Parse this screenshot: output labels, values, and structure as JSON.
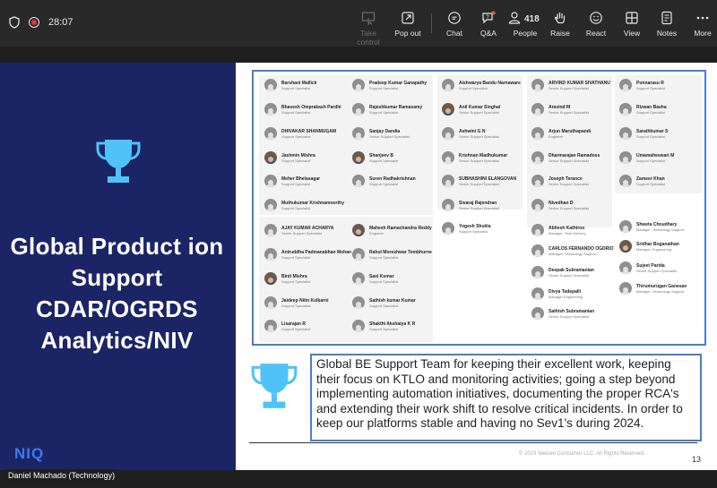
{
  "toolbar": {
    "elapsed_time": "28:07",
    "participant_count": "418",
    "buttons": {
      "take_control": "Take control",
      "pop_out": "Pop out",
      "chat": "Chat",
      "qa": "Q&A",
      "people": "People",
      "raise": "Raise",
      "react": "React",
      "view": "View",
      "notes": "Notes",
      "more": "More"
    }
  },
  "slide": {
    "title": "Global Product ion Support CDAR/OGRDS Analytics/NIV",
    "logo_text": "NIQ",
    "award_text": "Global BE Support Team for keeping their excellent work, keeping their focus on KTLO and monitoring activities; going a step beyond implementing automation initiatives, documenting the proper RCA's and extending their work shift to resolve critical incidents. In order to keep our platforms stable and having no Sev1's during 2024.",
    "copyright": "© 2023 Nielsen Consumer LLC. All Rights Reserved.",
    "page_number": "13",
    "roster": {
      "col1": [
        {
          "name": "Barshani Mallick",
          "role": "Support Specialist"
        },
        {
          "name": "Bhavesh Omprakash Pardhi",
          "role": "Support Specialist"
        },
        {
          "name": "DHIVAKAR SHANMUGAM",
          "role": "Support Specialist"
        },
        {
          "name": "Jashmin Mishra",
          "role": "Support Specialist"
        },
        {
          "name": "Meher Bhelasagar",
          "role": "Support Specialist"
        },
        {
          "name": "Muthukumar Krishnamoorthy",
          "role": "Support Specialist"
        },
        {
          "name": "AJAY KUMAR ACHARYA",
          "role": "Senior Support Specialist"
        },
        {
          "name": "Aniruddha Padmanabhan Mohan",
          "role": "Support Specialist"
        },
        {
          "name": "Binit Mishra",
          "role": "Support Specialist"
        },
        {
          "name": "Jaideep Nitin Kulkarni",
          "role": "Support Specialist"
        },
        {
          "name": "Lisarajan R",
          "role": "Support Specialist"
        }
      ],
      "col2": [
        {
          "name": "Pradeep Kumar Ganapathy",
          "role": "Support Specialist"
        },
        {
          "name": "Rajeshkumar Ramasamy",
          "role": "Support Specialist"
        },
        {
          "name": "Sanjay Dandia",
          "role": "Senior Support Specialist"
        },
        {
          "name": "Shanjeev B",
          "role": "Support Specialist"
        },
        {
          "name": "Suren Radhakrishnan",
          "role": "Support Specialist"
        },
        {
          "name": "Mahesh Ramachandra Reddy",
          "role": "Engineer"
        },
        {
          "name": "Rahul Moreshwar Tembhurne",
          "role": "Support Specialist"
        },
        {
          "name": "Sasi Kumar",
          "role": "Support Specialist"
        },
        {
          "name": "Sathish kumar Kumar",
          "role": "Support Specialist"
        },
        {
          "name": "Shakthi Akshaiya K R",
          "role": "Support Specialist"
        }
      ],
      "col3": [
        {
          "name": "Aishwarya Bandu Narnaware",
          "role": "Support Specialist"
        },
        {
          "name": "Anil Kumar Singhal",
          "role": "Senior Support Specialist"
        },
        {
          "name": "Ashwini G N",
          "role": "Senior Support Specialist"
        },
        {
          "name": "Krishnan Madhukumar",
          "role": "Senior Support Specialist"
        },
        {
          "name": "SUBHASHINI ELANGOVAN",
          "role": "Senior Support Specialist"
        },
        {
          "name": "Sivaraj Rajendran",
          "role": "Senior Support Specialist"
        },
        {
          "name": "Yogesh Shukla",
          "role": "Support Specialist"
        }
      ],
      "col4": [
        {
          "name": "ARVIND KUMAR SIVATHANU",
          "role": "Senior Support Specialist"
        },
        {
          "name": "Aravind M",
          "role": "Senior Support Specialist"
        },
        {
          "name": "Arjun Maruthapandi",
          "role": "Engineer"
        },
        {
          "name": "Dharmarajan Ramadoss",
          "role": "Senior Support Specialist"
        },
        {
          "name": "Joseph Terance",
          "role": "Senior Support Specialist"
        },
        {
          "name": "Nivedhan D",
          "role": "Senior Support Specialist"
        },
        {
          "name": "Abhesh Kathiroo",
          "role": "Manager, Tech Delivery"
        },
        {
          "name": "CARLOS FERNANDO OGDRIO",
          "role": "Manager, Technology Support"
        },
        {
          "name": "Deepak Subramanian",
          "role": "Senior Support Specialist"
        },
        {
          "name": "Divya Tadepalli",
          "role": "Manager Engineering"
        },
        {
          "name": "Sathish Subramanian",
          "role": "Senior Support Specialist"
        }
      ],
      "col5": [
        {
          "name": "Ponnarasu R",
          "role": "Support Specialist"
        },
        {
          "name": "Rizwan Basha",
          "role": "Support Specialist"
        },
        {
          "name": "Sarathkumar S",
          "role": "Support Specialist"
        },
        {
          "name": "Umamaheswari M",
          "role": "Support Specialist"
        },
        {
          "name": "Zameer Khan",
          "role": "Support Specialist"
        },
        {
          "name": "Shweta Choudhary",
          "role": "Manager, Technology Support"
        },
        {
          "name": "Sridhar Boganathan",
          "role": "Manager, Engineering"
        },
        {
          "name": "Sujeet Parida",
          "role": "Senior Support Specialist"
        },
        {
          "name": "Thirumurugan Ganesan",
          "role": "Manager, Technology Support"
        }
      ]
    }
  },
  "presenter": {
    "name": "Daniel Machado (Technology)"
  },
  "colors": {
    "slide_left_bg": "#1b2566",
    "trophy": "#4fc3f7",
    "frame_border": "#4a7bd0",
    "toolbar_bg": "#292929"
  }
}
